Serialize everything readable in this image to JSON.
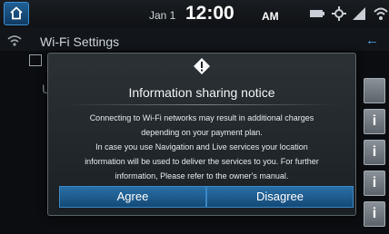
{
  "statusbar": {
    "date": "Jan 1",
    "time": "12:00",
    "ampm": "AM",
    "icons": [
      "battery-icon",
      "gps-icon",
      "signal-icon",
      "wifi-icon"
    ]
  },
  "background": {
    "title": "Wi-Fi Settings",
    "partial_letter": "U"
  },
  "dialog": {
    "title": "Information sharing notice",
    "body_lines": [
      "Connecting to Wi-Fi networks may result in additional charges",
      "depending on your payment plan.",
      "In case you use Navigation and Live services your location",
      "information will be used to deliver the services to you. For further",
      "information, Please refer to the owner's manual."
    ],
    "agree_label": "Agree",
    "disagree_label": "Disagree"
  },
  "side_buttons": [
    "",
    "i",
    "i",
    "i",
    "i"
  ],
  "colors": {
    "accent": "#2a6fa6",
    "dialog_bg": "#22282c"
  }
}
